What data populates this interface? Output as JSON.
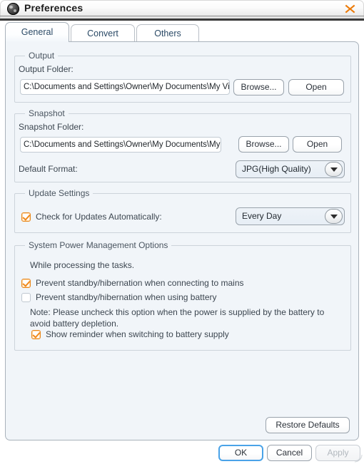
{
  "window": {
    "title": "Preferences",
    "icon": "app-sphere-icon",
    "close_icon": "close-x-icon",
    "close_color": "#ec7a08"
  },
  "tabs": [
    {
      "id": "general",
      "label": "General",
      "active": true
    },
    {
      "id": "convert",
      "label": "Convert",
      "active": false
    },
    {
      "id": "others",
      "label": "Others",
      "active": false
    }
  ],
  "general": {
    "output": {
      "group_title": "Output",
      "folder_label": "Output Folder:",
      "folder_value": "C:\\Documents and Settings\\Owner\\My Documents\\My Vid",
      "browse_label": "Browse...",
      "open_label": "Open"
    },
    "snapshot": {
      "group_title": "Snapshot",
      "folder_label": "Snapshot Folder:",
      "folder_value": "C:\\Documents and Settings\\Owner\\My Documents\\My Pict",
      "browse_label": "Browse...",
      "open_label": "Open",
      "format_label": "Default Format:",
      "format_value": "JPG(High Quality)"
    },
    "update": {
      "group_title": "Update Settings",
      "check_label": "Check for Updates Automatically:",
      "check_checked": true,
      "frequency_value": "Every Day"
    },
    "power": {
      "group_title": "System Power Management Options",
      "intro": "While processing the tasks.",
      "mains_label": "Prevent standby/hibernation when connecting to mains",
      "mains_checked": true,
      "battery_label": "Prevent standby/hibernation when using battery",
      "battery_checked": false,
      "note": "Note: Please uncheck this option when the power is supplied by the battery to avoid battery depletion.",
      "reminder_label": "Show reminder when switching to battery supply",
      "reminder_checked": true
    },
    "restore_label": "Restore Defaults"
  },
  "footer": {
    "ok_label": "OK",
    "cancel_label": "Cancel",
    "apply_label": "Apply",
    "apply_disabled": true,
    "default_focus_color": "#4aa3e8"
  }
}
